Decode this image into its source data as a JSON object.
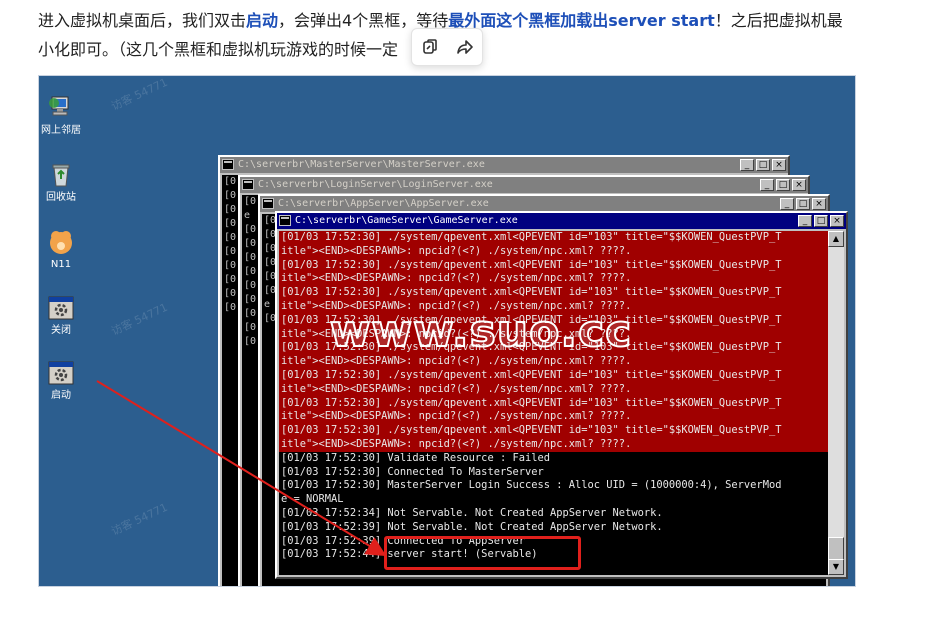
{
  "article": {
    "seg1": "进入虚拟机桌面后，我们双击",
    "seg2": "启动",
    "seg3": "，会弹出4个黑框，等待",
    "seg4": "最外面这个黑框加载出server start",
    "seg5": "！之后把虚拟机最",
    "seg6": "小化即可。（这几个黑框和虚拟机玩游戏的时候一定"
  },
  "popup": {
    "copy_icon": "copy-link-icon",
    "share_icon": "share-arrow-icon"
  },
  "desktop": {
    "icons": [
      {
        "label": "网上邻居",
        "icon": "network-neighborhood-icon"
      },
      {
        "label": "回收站",
        "icon": "recycle-bin-icon"
      },
      {
        "label": "N11",
        "icon": "n11-app-icon"
      },
      {
        "label": "关闭",
        "icon": "batch-file-icon"
      },
      {
        "label": "启动",
        "icon": "batch-file-icon"
      }
    ]
  },
  "windows": {
    "master": {
      "title": "C:\\serverbr\\MasterServer\\MasterServer.exe",
      "stub_lines": [
        "[0",
        "[0",
        "[0",
        "[0",
        "[0",
        "[0",
        "[0",
        "[0",
        "[0",
        "[0"
      ]
    },
    "login": {
      "title": "C:\\serverbr\\LoginServer\\LoginServer.exe",
      "stub_lines": [
        "[0",
        "e",
        "[0",
        "[0",
        "[0",
        "[0",
        "[0",
        "[0",
        "[0",
        "[0",
        "[0"
      ]
    },
    "app": {
      "title": "C:\\serverbr\\AppServer\\AppServer.exe",
      "stub_lines": [
        "[0",
        "[0",
        "[0",
        "[0",
        "[0",
        "[0",
        "e",
        "[0"
      ]
    },
    "game": {
      "title": "C:\\serverbr\\GameServer\\GameServer.exe",
      "red_lines": [
        "[01/03 17:52:30] ./system/qpevent.xml<QPEVENT id=\"103\" title=\"$$KOWEN_QuestPVP_T",
        "itle\"><END><DESPAWN>: npcid?(<?) ./system/npc.xml? ????.",
        "[01/03 17:52:30] ./system/qpevent.xml<QPEVENT id=\"103\" title=\"$$KOWEN_QuestPVP_T",
        "itle\"><END><DESPAWN>: npcid?(<?) ./system/npc.xml? ????.",
        "[01/03 17:52:30] ./system/qpevent.xml<QPEVENT id=\"103\" title=\"$$KOWEN_QuestPVP_T",
        "itle\"><END><DESPAWN>: npcid?(<?) ./system/npc.xml? ????.",
        "[01/03 17:52:30] ./system/qpevent.xml<QPEVENT id=\"103\" title=\"$$KOWEN_QuestPVP_T",
        "itle\"><END><DESPAWN>: npcid?(<?) ./system/npc.xml? ????.",
        "[01/03 17:52:30] ./system/qpevent.xml<QPEVENT id=\"103\" title=\"$$KOWEN_QuestPVP_T",
        "itle\"><END><DESPAWN>: npcid?(<?) ./system/npc.xml? ????.",
        "[01/03 17:52:30] ./system/qpevent.xml<QPEVENT id=\"103\" title=\"$$KOWEN_QuestPVP_T",
        "itle\"><END><DESPAWN>: npcid?(<?) ./system/npc.xml? ????.",
        "[01/03 17:52:30] ./system/qpevent.xml<QPEVENT id=\"103\" title=\"$$KOWEN_QuestPVP_T",
        "itle\"><END><DESPAWN>: npcid?(<?) ./system/npc.xml? ????.",
        "[01/03 17:52:30] ./system/qpevent.xml<QPEVENT id=\"103\" title=\"$$KOWEN_QuestPVP_T",
        "itle\"><END><DESPAWN>: npcid?(<?) ./system/npc.xml? ????."
      ],
      "black_lines": [
        "[01/03 17:52:30] Validate Resource : Failed",
        "[01/03 17:52:30] Connected To MasterServer",
        "[01/03 17:52:30] MasterServer Login Success : Alloc UID = (1000000:4), ServerMod",
        "e = NORMAL",
        "[01/03 17:52:34] Not Servable. Not Created AppServer Network.",
        "[01/03 17:52:39] Not Servable. Not Created AppServer Network.",
        "[01/03 17:52:39] Connected To AppServer",
        "[01/03 17:52:44] server start! (Servable)"
      ]
    }
  },
  "watermark": "www.suo.cc",
  "faint_watermark": "访客 54771",
  "colors": {
    "desktop": "#2c5e8f",
    "active_title": "#000080",
    "error_block": "#a00000",
    "highlight": "#e0201c",
    "link": "#1d4fb8"
  }
}
